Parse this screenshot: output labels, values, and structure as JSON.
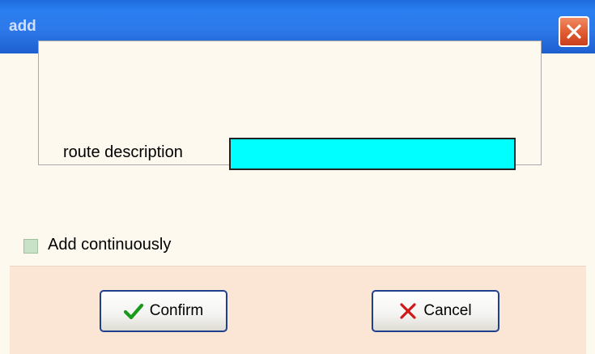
{
  "window": {
    "title": "add"
  },
  "form": {
    "route_description_label": "route description",
    "route_description_value": ""
  },
  "options": {
    "add_continuously_label": "Add continuously",
    "add_continuously_checked": false
  },
  "buttons": {
    "confirm_label": "Confirm",
    "cancel_label": "Cancel"
  },
  "icons": {
    "close": "close-icon",
    "confirm": "checkmark-icon",
    "cancel": "cross-icon"
  },
  "colors": {
    "titlebar": "#2a7ff0",
    "input_background": "#00ffff",
    "window_background": "#fdf9ef",
    "footer_background": "#fbe6d6",
    "checkmark": "#1a9a1a",
    "cancel_cross": "#d01818"
  }
}
